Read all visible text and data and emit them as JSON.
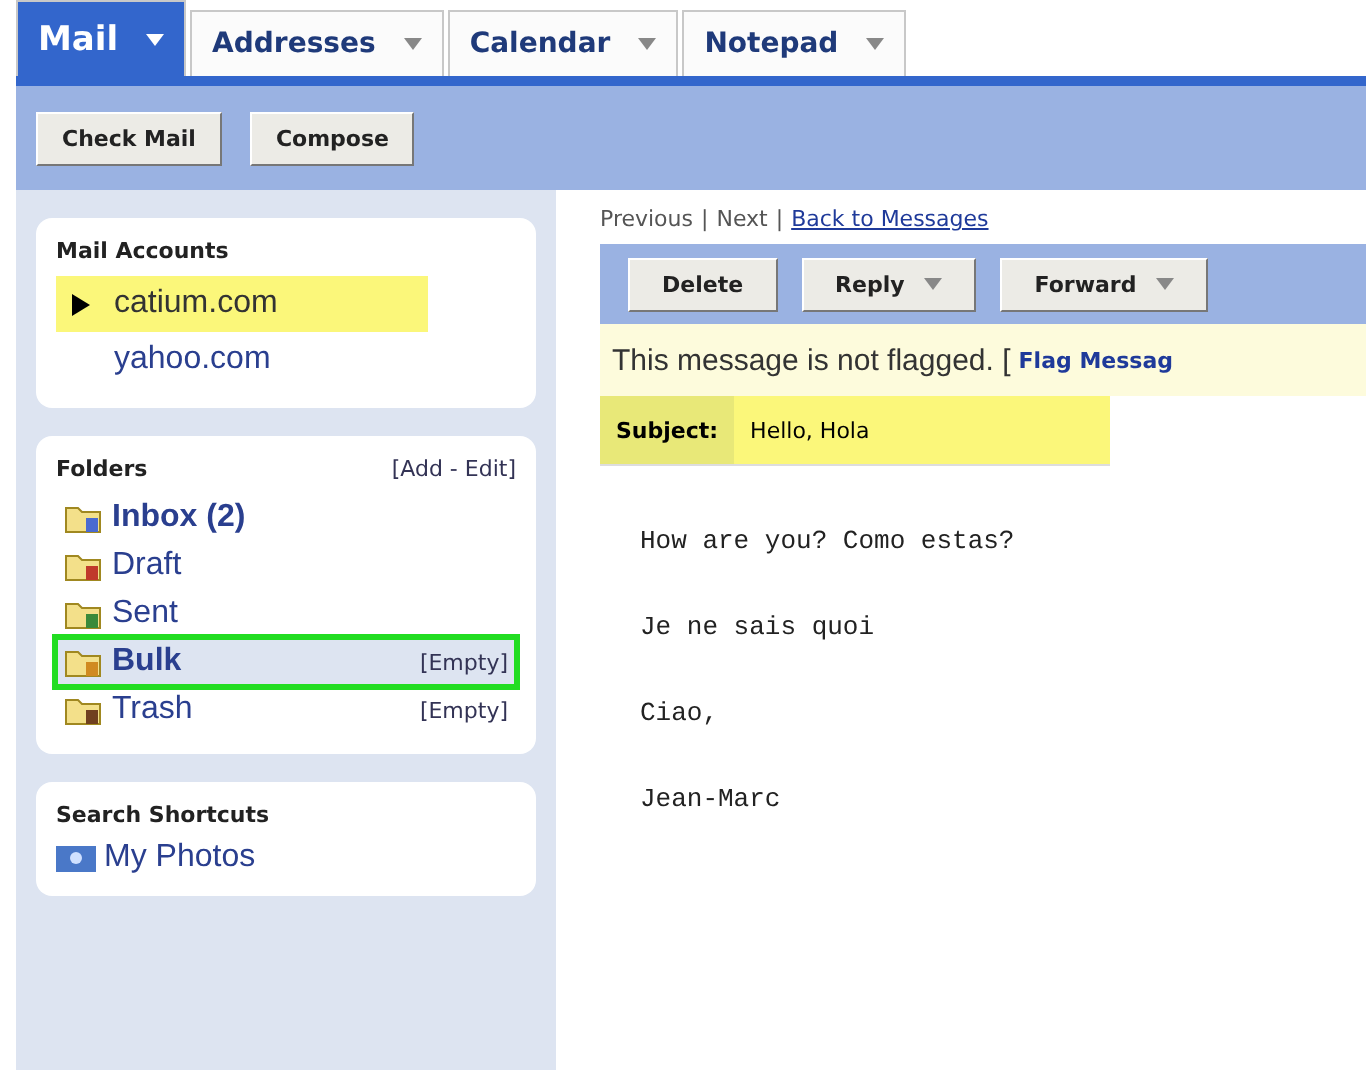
{
  "tabs": [
    {
      "label": "Mail",
      "selected": true
    },
    {
      "label": "Addresses",
      "selected": false
    },
    {
      "label": "Calendar",
      "selected": false
    },
    {
      "label": "Notepad",
      "selected": false
    }
  ],
  "toolbar": [
    "Check Mail",
    "Compose"
  ],
  "accounts": {
    "title": "Mail Accounts",
    "items": [
      {
        "label": "catium.com",
        "selected": true
      },
      {
        "label": "yahoo.com",
        "selected": false
      }
    ]
  },
  "folders": {
    "title": "Folders",
    "action": "[Add - Edit]",
    "items": [
      {
        "label": "Inbox (2)",
        "unread": true,
        "selected": false,
        "kind": "inbox"
      },
      {
        "label": "Draft",
        "unread": false,
        "selected": false,
        "kind": "draft"
      },
      {
        "label": "Sent",
        "unread": false,
        "selected": false,
        "kind": "sent"
      },
      {
        "label": "Bulk",
        "unread": true,
        "selected": true,
        "kind": "bulk",
        "action": "[Empty]"
      },
      {
        "label": "Trash",
        "unread": false,
        "selected": false,
        "kind": "trash",
        "action": "[Empty]"
      }
    ]
  },
  "shortcuts": {
    "title": "Search Shortcuts",
    "items": [
      {
        "label": "My Photos"
      }
    ]
  },
  "nav": {
    "previous": "Previous",
    "next": "Next",
    "back": "Back to Messages",
    "separator": "|"
  },
  "message_buttons": [
    {
      "label": "Delete",
      "menu": false
    },
    {
      "label": "Reply",
      "menu": true
    },
    {
      "label": "Forward",
      "menu": true
    }
  ],
  "flag": {
    "text": "This message is not flagged. [",
    "link": "Flag Messag"
  },
  "subject": {
    "label": "Subject:",
    "value": "Hello, Hola",
    "highlighted": true
  },
  "body": [
    "How are you? Como estas?",
    "Je ne sais quoi",
    "Ciao,",
    "Jean-Marc"
  ]
}
